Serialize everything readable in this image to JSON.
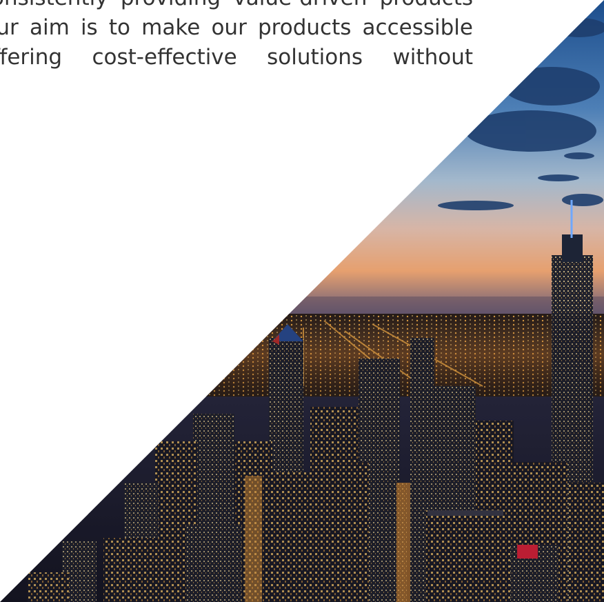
{
  "intro": {
    "lines": [
      "consistently providing value-driven products",
      "Our aim is to make our products accessible",
      "offering cost-effective solutions without"
    ]
  },
  "image": {
    "subject": "city-skyline-at-dusk",
    "accent_colors": [
      "#1e4f8a",
      "#f4a860",
      "#f7b046",
      "#3a2a4a"
    ]
  }
}
